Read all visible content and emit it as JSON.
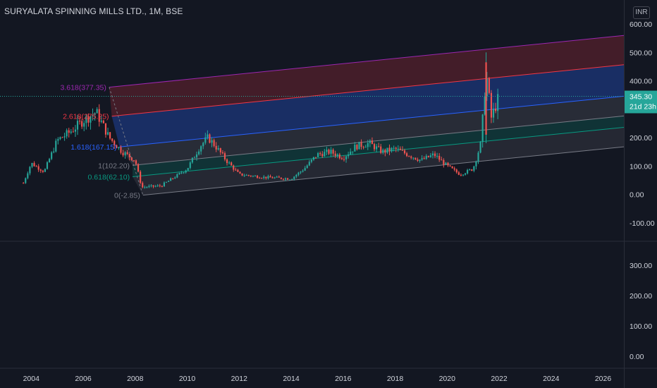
{
  "header": {
    "symbol_title": "SURYALATA SPINNING MILLS LTD., 1M, BSE",
    "currency": "INR"
  },
  "colors": {
    "background": "#131722",
    "axis_text": "#d1d4dc",
    "up_candle": "#26a69a",
    "down_candle": "#ef5350",
    "last_price_label": "#26a69a",
    "fib_3618": "#9c27b0",
    "fib_2618": "#f23645",
    "fib_1618": "#2962ff",
    "fib_1": "#787b86",
    "fib_0618": "#089981",
    "fib_0": "#787b86"
  },
  "price_axis": {
    "main_ticks": [
      "600.00",
      "500.00",
      "400.00",
      "300.00",
      "200.00",
      "100.00",
      "0.00",
      "-100.00"
    ],
    "lower_ticks": [
      "300.00",
      "200.00",
      "100.00",
      "0.00"
    ]
  },
  "time_axis": {
    "ticks": [
      "2004",
      "2006",
      "2008",
      "2010",
      "2012",
      "2014",
      "2016",
      "2018",
      "2020",
      "2022",
      "2024",
      "2026"
    ]
  },
  "last_price": {
    "value": "345.30",
    "countdown": "21d 23h"
  },
  "fib_levels": [
    {
      "label": "3.618(377.35)",
      "ratio": 3.618,
      "price": 377.35
    },
    {
      "label": "2.618(275.25)",
      "ratio": 2.618,
      "price": 275.25
    },
    {
      "label": "1.618(167.15)",
      "ratio": 1.618,
      "price": 167.15
    },
    {
      "label": "1(102.20)",
      "ratio": 1,
      "price": 102.2
    },
    {
      "label": "0.618(62.10)",
      "ratio": 0.618,
      "price": 62.1
    },
    {
      "label": "0(-2.85)",
      "ratio": 0,
      "price": -2.85
    }
  ],
  "chart_data": {
    "type": "candlestick",
    "interval": "1M",
    "y_range": [
      -170,
      650
    ],
    "x_range": [
      2002.8,
      2026.8
    ],
    "anchors": [
      {
        "year": 2003.7,
        "price": 40
      },
      {
        "year": 2004.0,
        "price": 110
      },
      {
        "year": 2004.5,
        "price": 80
      },
      {
        "year": 2005.0,
        "price": 190
      },
      {
        "year": 2005.5,
        "price": 220
      },
      {
        "year": 2006.0,
        "price": 260
      },
      {
        "year": 2006.5,
        "price": 290
      },
      {
        "year": 2007.0,
        "price": 200
      },
      {
        "year": 2007.5,
        "price": 150
      },
      {
        "year": 2008.0,
        "price": 120
      },
      {
        "year": 2008.25,
        "price": 25
      },
      {
        "year": 2009.0,
        "price": 30
      },
      {
        "year": 2009.5,
        "price": 60
      },
      {
        "year": 2010.0,
        "price": 90
      },
      {
        "year": 2010.5,
        "price": 170
      },
      {
        "year": 2010.8,
        "price": 200
      },
      {
        "year": 2011.0,
        "price": 180
      },
      {
        "year": 2011.5,
        "price": 120
      },
      {
        "year": 2012.0,
        "price": 70
      },
      {
        "year": 2013.0,
        "price": 60
      },
      {
        "year": 2014.0,
        "price": 55
      },
      {
        "year": 2014.5,
        "price": 90
      },
      {
        "year": 2015.0,
        "price": 140
      },
      {
        "year": 2015.5,
        "price": 150
      },
      {
        "year": 2016.0,
        "price": 130
      },
      {
        "year": 2016.5,
        "price": 170
      },
      {
        "year": 2017.0,
        "price": 180
      },
      {
        "year": 2017.5,
        "price": 150
      },
      {
        "year": 2018.0,
        "price": 160
      },
      {
        "year": 2018.5,
        "price": 140
      },
      {
        "year": 2019.0,
        "price": 120
      },
      {
        "year": 2019.5,
        "price": 140
      },
      {
        "year": 2020.0,
        "price": 100
      },
      {
        "year": 2020.5,
        "price": 70
      },
      {
        "year": 2021.0,
        "price": 90
      },
      {
        "year": 2021.3,
        "price": 180
      },
      {
        "year": 2021.5,
        "price": 430
      },
      {
        "year": 2021.7,
        "price": 270
      },
      {
        "year": 2022.0,
        "price": 345
      }
    ],
    "volume_pane": {
      "y_range": [
        -60,
        370
      ]
    }
  }
}
